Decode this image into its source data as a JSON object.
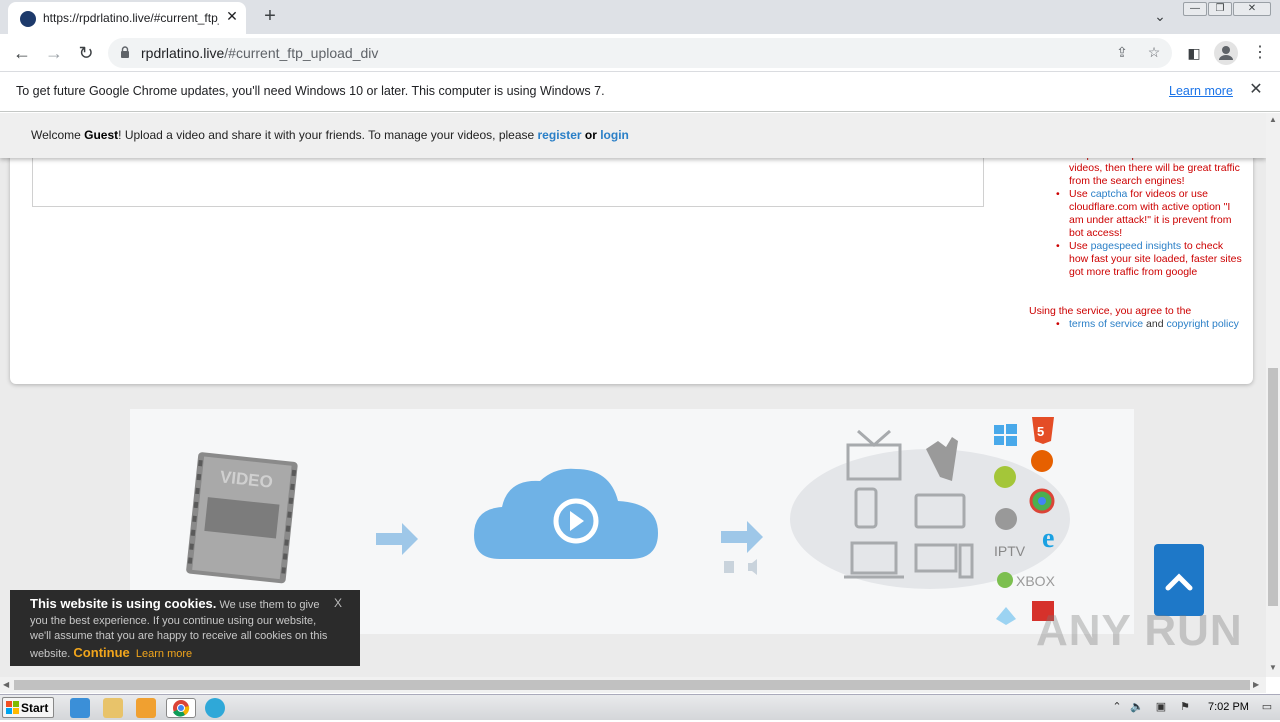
{
  "browser": {
    "tab_title": "https://rpdrlatino.live/#current_ftp_",
    "new_tab": "+",
    "tab_close": "✕",
    "url_host": "rpdrlatino.live",
    "url_path": "/#current_ftp_upload_div",
    "window_controls": [
      "—",
      "❐",
      "✕"
    ]
  },
  "infobar": {
    "message": "To get future Google Chrome updates, you'll need Windows 10 or later. This computer is using Windows 7.",
    "learn_more": "Learn more",
    "close": "✕"
  },
  "welcome": {
    "prefix": "Welcome ",
    "user": "Guest",
    "middle": "! Upload a video and share it with your friends. To manage your videos, please ",
    "register": "register",
    "or": " or ",
    "login": "login"
  },
  "sidebar": {
    "tip1_cut": "unique description for the",
    "tip1_rest": "videos, then there will be great traffic from the search engines!",
    "tip2_a": "Use ",
    "tip2_link": "captcha",
    "tip2_b": " for videos or use cloudflare.com with active option \"I am under attack!\" it is prevent from bot access!",
    "tip3_a": "Use ",
    "tip3_link": "pagespeed insights",
    "tip3_b": " to check how fast your site loaded, faster sites got more traffic from google",
    "agree": "Using the service, you agree to the",
    "tos": "terms of service",
    "and": " and ",
    "copyright": "copyright policy"
  },
  "hero": {
    "film_label": "VIDEO",
    "iptv": "IPTV",
    "xbox": "XBOX",
    "html5": "5"
  },
  "cookie": {
    "heading": "This website is using cookies.",
    "body": " We use them to give you the best experience. If you continue using our website, we'll assume that you are happy to receive all cookies on this website. ",
    "continue": "Continue",
    "learn_more": "Learn more",
    "close": "X"
  },
  "watermark": "ANY RUN",
  "taskbar": {
    "start": "Start",
    "clock": "7:02 PM"
  }
}
